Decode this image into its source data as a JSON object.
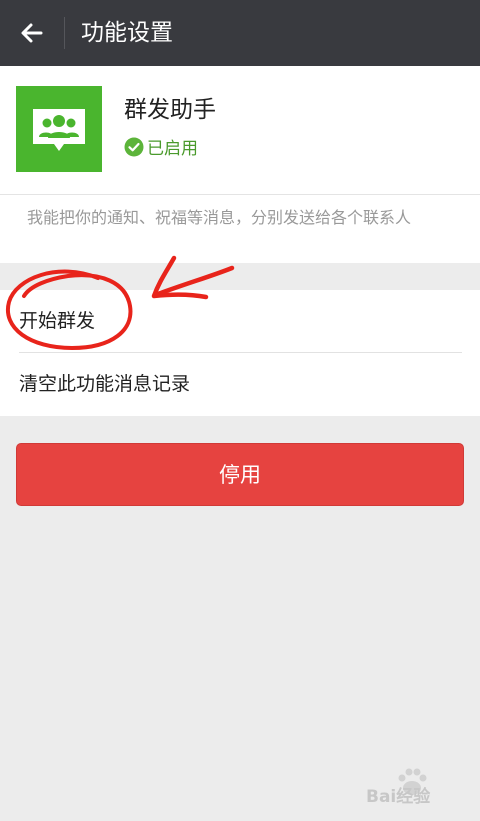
{
  "topbar": {
    "title": "功能设置",
    "back_icon": "arrow-left-icon"
  },
  "app": {
    "name": "群发助手",
    "status": "已启用",
    "icon": "group-message-icon",
    "accent_color": "#4ab52e"
  },
  "description": "我能把你的通知、祝福等消息，分别发送给各个联系人",
  "menu": {
    "items": [
      {
        "label": "开始群发"
      },
      {
        "label": "清空此功能消息记录"
      }
    ]
  },
  "disable_button": {
    "label": "停用",
    "color": "#e64340"
  },
  "watermark": {
    "text": "Bai经验"
  }
}
